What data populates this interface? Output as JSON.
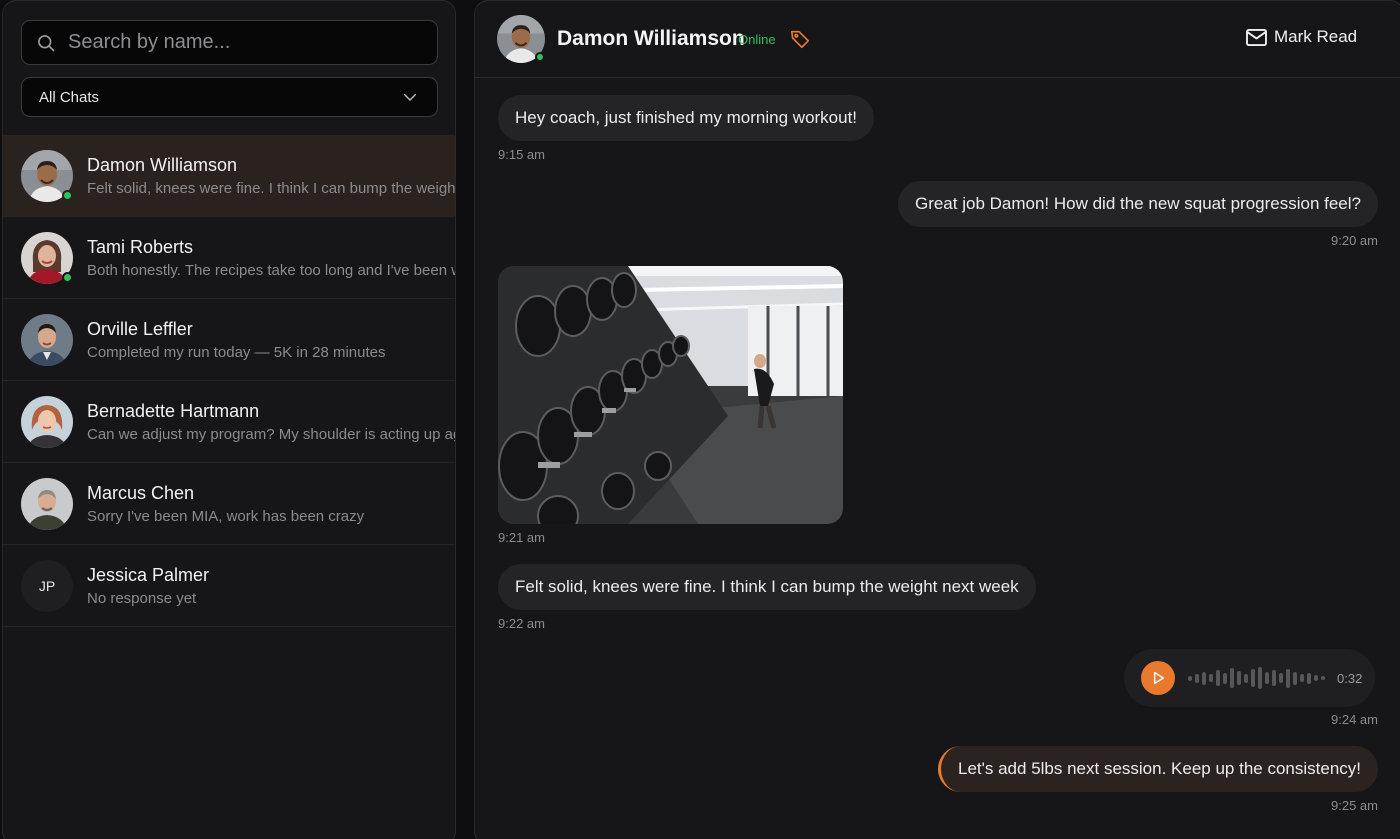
{
  "sidebar": {
    "search": {
      "placeholder": "Search by name..."
    },
    "filter": {
      "selected": "All Chats"
    },
    "chats": [
      {
        "name": "Damon Williamson",
        "preview": "Felt solid, knees were fine. I think I can bump the weight next week",
        "online": true,
        "active": true
      },
      {
        "name": "Tami Roberts",
        "preview": "Both honestly. The recipes take too long and I've been working late",
        "online": true,
        "active": false
      },
      {
        "name": "Orville Leffler",
        "preview": "Completed my run today — 5K in 28 minutes",
        "online": false,
        "active": false
      },
      {
        "name": "Bernadette Hartmann",
        "preview": "Can we adjust my program? My shoulder is acting up again",
        "online": false,
        "active": false
      },
      {
        "name": "Marcus Chen",
        "preview": "Sorry I've been MIA, work has been crazy",
        "online": false,
        "active": false
      },
      {
        "name": "Jessica Palmer",
        "preview": "No response yet",
        "initials": "JP",
        "online": false,
        "active": false
      }
    ]
  },
  "header": {
    "contact_name": "Damon Williamson",
    "status": "Online",
    "mark_read_label": "Mark Read"
  },
  "messages": [
    {
      "from": "client",
      "type": "text",
      "text": "Hey coach, just finished my morning workout!",
      "time": "9:15 am"
    },
    {
      "from": "coach",
      "type": "text",
      "text": "Great job Damon! How did the new squat progression feel?",
      "time": "9:20 am"
    },
    {
      "from": "client",
      "type": "image",
      "alt": "gym dumbbell rack photo",
      "time": "9:21 am"
    },
    {
      "from": "client",
      "type": "text",
      "text": "Felt solid, knees were fine. I think I can bump the weight next week",
      "time": "9:22 am"
    },
    {
      "from": "coach",
      "type": "voice",
      "duration": "0:32",
      "time": "9:24 am"
    },
    {
      "from": "coach",
      "type": "text",
      "text": "Let's add 5lbs next session. Keep up the consistency!",
      "time": "9:25 am"
    }
  ],
  "colors": {
    "accent": "#e8792f",
    "online": "#2fc15b",
    "background": "#0e0e10",
    "panel": "#161618",
    "active_row": "#2a221e"
  },
  "icons": [
    "search-icon",
    "chevron-down-icon",
    "tag-icon",
    "mail-icon",
    "play-icon"
  ]
}
